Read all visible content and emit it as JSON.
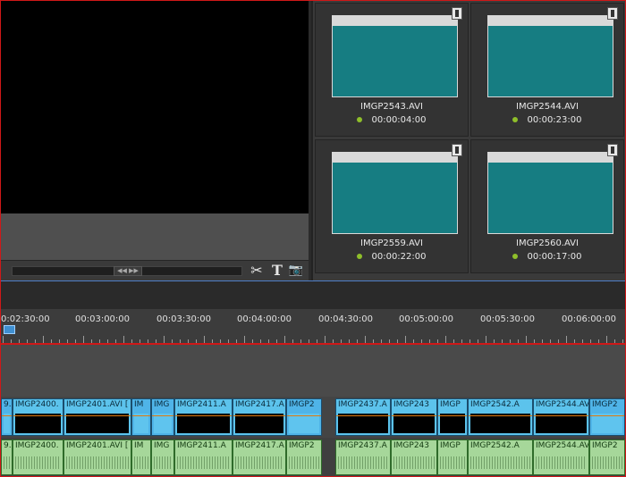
{
  "media_bin": {
    "items": [
      {
        "name": "IMGP2543.AVI",
        "duration": "00:00:04:00"
      },
      {
        "name": "IMGP2544.AVI",
        "duration": "00:00:23:00"
      },
      {
        "name": "IMGP2559.AVI",
        "duration": "00:00:22:00"
      },
      {
        "name": "IMGP2560.AVI",
        "duration": "00:00:17:00"
      }
    ]
  },
  "preview": {
    "tools": {
      "cut": "✂",
      "title": "T",
      "snapshot": "📷"
    },
    "scrub_handle": "◀◀ ▶▶"
  },
  "timeline": {
    "timecodes": [
      "0:02:30:00",
      "00:03:00:00",
      "00:03:30:00",
      "00:04:00:00",
      "00:04:30:00",
      "00:05:00:00",
      "00:05:30:00",
      "00:06:00:00"
    ],
    "video_clips": [
      "9.",
      "IMGP2400.",
      "IMGP2401.AVI [",
      "IM",
      "IMG",
      "IMGP2411.A",
      "IMGP2417.A",
      "IMGP2",
      "IMGP2437.A",
      "IMGP243",
      "IMGP",
      "IMGP2542.A",
      "IMGP2544.AV",
      "IMGP2"
    ],
    "audio_clips": [
      "9.",
      "IMGP2400.",
      "IMGP2401.AVI [",
      "IM",
      "IMG",
      "IMGP2411.A",
      "IMGP2417.A",
      "IMGP2",
      "IMGP2437.A",
      "IMGP243",
      "IMGP",
      "IMGP2542.A",
      "IMGP2544.AV",
      "IMGP2"
    ]
  },
  "colors": {
    "accent_border": "#d01818",
    "thumb": "#167d82",
    "video_clip": "#5cc3ec",
    "audio_clip": "#a6d79a",
    "status_dot": "#8fbf2a"
  }
}
